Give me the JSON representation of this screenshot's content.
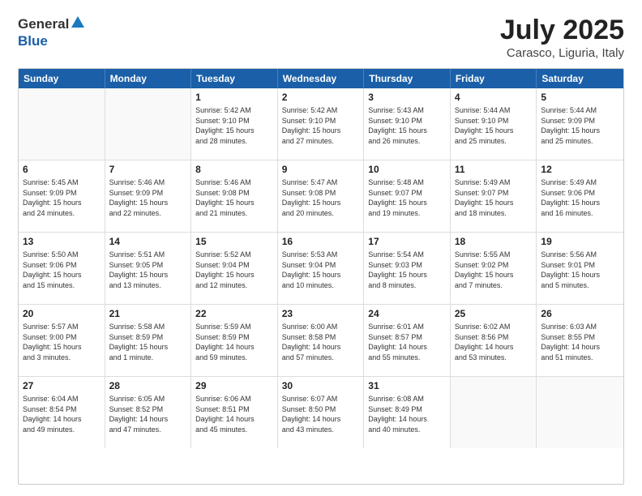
{
  "header": {
    "logo_general": "General",
    "logo_blue": "Blue",
    "month_title": "July 2025",
    "location": "Carasco, Liguria, Italy"
  },
  "calendar": {
    "days_of_week": [
      "Sunday",
      "Monday",
      "Tuesday",
      "Wednesday",
      "Thursday",
      "Friday",
      "Saturday"
    ],
    "weeks": [
      [
        {
          "day": "",
          "info": ""
        },
        {
          "day": "",
          "info": ""
        },
        {
          "day": "1",
          "info": "Sunrise: 5:42 AM\nSunset: 9:10 PM\nDaylight: 15 hours\nand 28 minutes."
        },
        {
          "day": "2",
          "info": "Sunrise: 5:42 AM\nSunset: 9:10 PM\nDaylight: 15 hours\nand 27 minutes."
        },
        {
          "day": "3",
          "info": "Sunrise: 5:43 AM\nSunset: 9:10 PM\nDaylight: 15 hours\nand 26 minutes."
        },
        {
          "day": "4",
          "info": "Sunrise: 5:44 AM\nSunset: 9:10 PM\nDaylight: 15 hours\nand 25 minutes."
        },
        {
          "day": "5",
          "info": "Sunrise: 5:44 AM\nSunset: 9:09 PM\nDaylight: 15 hours\nand 25 minutes."
        }
      ],
      [
        {
          "day": "6",
          "info": "Sunrise: 5:45 AM\nSunset: 9:09 PM\nDaylight: 15 hours\nand 24 minutes."
        },
        {
          "day": "7",
          "info": "Sunrise: 5:46 AM\nSunset: 9:09 PM\nDaylight: 15 hours\nand 22 minutes."
        },
        {
          "day": "8",
          "info": "Sunrise: 5:46 AM\nSunset: 9:08 PM\nDaylight: 15 hours\nand 21 minutes."
        },
        {
          "day": "9",
          "info": "Sunrise: 5:47 AM\nSunset: 9:08 PM\nDaylight: 15 hours\nand 20 minutes."
        },
        {
          "day": "10",
          "info": "Sunrise: 5:48 AM\nSunset: 9:07 PM\nDaylight: 15 hours\nand 19 minutes."
        },
        {
          "day": "11",
          "info": "Sunrise: 5:49 AM\nSunset: 9:07 PM\nDaylight: 15 hours\nand 18 minutes."
        },
        {
          "day": "12",
          "info": "Sunrise: 5:49 AM\nSunset: 9:06 PM\nDaylight: 15 hours\nand 16 minutes."
        }
      ],
      [
        {
          "day": "13",
          "info": "Sunrise: 5:50 AM\nSunset: 9:06 PM\nDaylight: 15 hours\nand 15 minutes."
        },
        {
          "day": "14",
          "info": "Sunrise: 5:51 AM\nSunset: 9:05 PM\nDaylight: 15 hours\nand 13 minutes."
        },
        {
          "day": "15",
          "info": "Sunrise: 5:52 AM\nSunset: 9:04 PM\nDaylight: 15 hours\nand 12 minutes."
        },
        {
          "day": "16",
          "info": "Sunrise: 5:53 AM\nSunset: 9:04 PM\nDaylight: 15 hours\nand 10 minutes."
        },
        {
          "day": "17",
          "info": "Sunrise: 5:54 AM\nSunset: 9:03 PM\nDaylight: 15 hours\nand 8 minutes."
        },
        {
          "day": "18",
          "info": "Sunrise: 5:55 AM\nSunset: 9:02 PM\nDaylight: 15 hours\nand 7 minutes."
        },
        {
          "day": "19",
          "info": "Sunrise: 5:56 AM\nSunset: 9:01 PM\nDaylight: 15 hours\nand 5 minutes."
        }
      ],
      [
        {
          "day": "20",
          "info": "Sunrise: 5:57 AM\nSunset: 9:00 PM\nDaylight: 15 hours\nand 3 minutes."
        },
        {
          "day": "21",
          "info": "Sunrise: 5:58 AM\nSunset: 8:59 PM\nDaylight: 15 hours\nand 1 minute."
        },
        {
          "day": "22",
          "info": "Sunrise: 5:59 AM\nSunset: 8:59 PM\nDaylight: 14 hours\nand 59 minutes."
        },
        {
          "day": "23",
          "info": "Sunrise: 6:00 AM\nSunset: 8:58 PM\nDaylight: 14 hours\nand 57 minutes."
        },
        {
          "day": "24",
          "info": "Sunrise: 6:01 AM\nSunset: 8:57 PM\nDaylight: 14 hours\nand 55 minutes."
        },
        {
          "day": "25",
          "info": "Sunrise: 6:02 AM\nSunset: 8:56 PM\nDaylight: 14 hours\nand 53 minutes."
        },
        {
          "day": "26",
          "info": "Sunrise: 6:03 AM\nSunset: 8:55 PM\nDaylight: 14 hours\nand 51 minutes."
        }
      ],
      [
        {
          "day": "27",
          "info": "Sunrise: 6:04 AM\nSunset: 8:54 PM\nDaylight: 14 hours\nand 49 minutes."
        },
        {
          "day": "28",
          "info": "Sunrise: 6:05 AM\nSunset: 8:52 PM\nDaylight: 14 hours\nand 47 minutes."
        },
        {
          "day": "29",
          "info": "Sunrise: 6:06 AM\nSunset: 8:51 PM\nDaylight: 14 hours\nand 45 minutes."
        },
        {
          "day": "30",
          "info": "Sunrise: 6:07 AM\nSunset: 8:50 PM\nDaylight: 14 hours\nand 43 minutes."
        },
        {
          "day": "31",
          "info": "Sunrise: 6:08 AM\nSunset: 8:49 PM\nDaylight: 14 hours\nand 40 minutes."
        },
        {
          "day": "",
          "info": ""
        },
        {
          "day": "",
          "info": ""
        }
      ]
    ]
  }
}
